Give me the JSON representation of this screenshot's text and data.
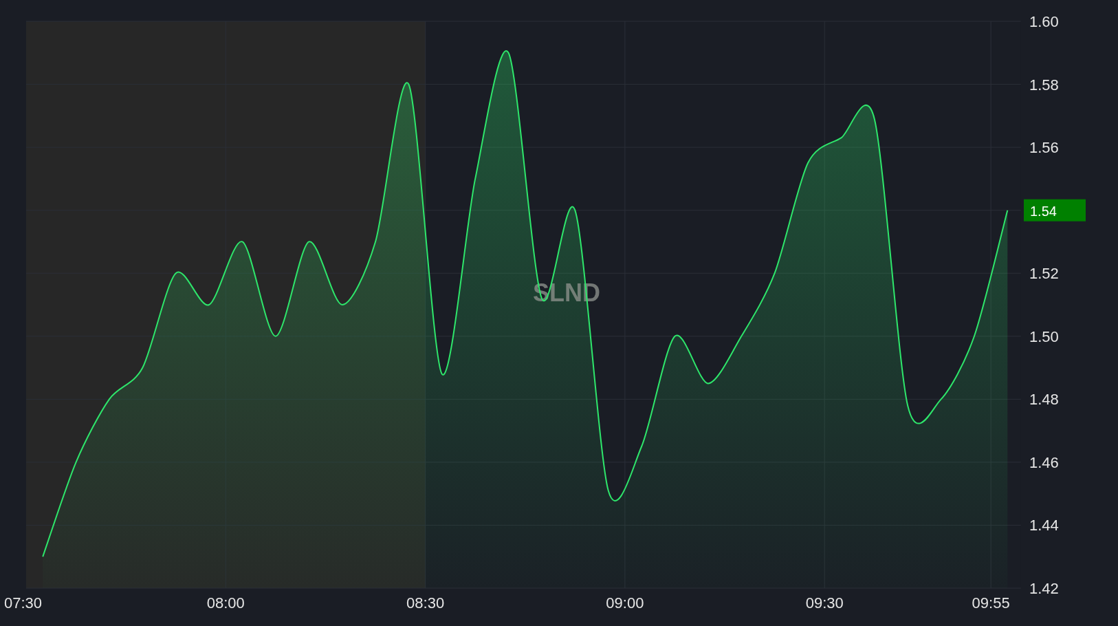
{
  "chart": {
    "last_price": "1.54",
    "chart_data": {
      "type": "area",
      "x": [
        7.5417,
        7.625,
        7.7083,
        7.7917,
        7.875,
        7.9583,
        8.0417,
        8.125,
        8.2083,
        8.2917,
        8.375,
        8.4583,
        8.5417,
        8.625,
        8.7083,
        8.7917,
        8.875,
        8.9583,
        9.0417,
        9.125,
        9.2083,
        9.2917,
        9.375,
        9.4583,
        9.5417,
        9.625,
        9.7083,
        9.7917,
        9.875,
        9.9583
      ],
      "series": [
        {
          "name": "SLND",
          "color": "#2ee66b",
          "values": [
            1.43,
            1.46,
            1.48,
            1.49,
            1.52,
            1.51,
            1.53,
            1.5,
            1.53,
            1.51,
            1.53,
            1.58,
            1.488,
            1.55,
            1.59,
            1.512,
            1.54,
            1.451,
            1.465,
            1.5,
            1.485,
            1.5,
            1.52,
            1.555,
            1.563,
            1.569,
            1.478,
            1.48,
            1.5,
            1.54
          ]
        }
      ],
      "grid": true,
      "xlim": [
        7.5,
        9.9917
      ],
      "ylim": [
        1.42,
        1.6
      ],
      "xticks": [
        {
          "value": 7.5,
          "label": "07:30"
        },
        {
          "value": 8.0,
          "label": "08:00"
        },
        {
          "value": 8.5,
          "label": "08:30"
        },
        {
          "value": 9.0,
          "label": "09:00"
        },
        {
          "value": 9.5,
          "label": "09:30"
        },
        {
          "value": 9.9167,
          "label": "09:55"
        }
      ],
      "yticks": [
        {
          "value": 1.42,
          "label": "1.42"
        },
        {
          "value": 1.44,
          "label": "1.44"
        },
        {
          "value": 1.46,
          "label": "1.46"
        },
        {
          "value": 1.48,
          "label": "1.48"
        },
        {
          "value": 1.5,
          "label": "1.50"
        },
        {
          "value": 1.52,
          "label": "1.52"
        },
        {
          "value": 1.56,
          "label": "1.56"
        },
        {
          "value": 1.58,
          "label": "1.58"
        },
        {
          "value": 1.6,
          "label": "1.60"
        }
      ]
    }
  }
}
